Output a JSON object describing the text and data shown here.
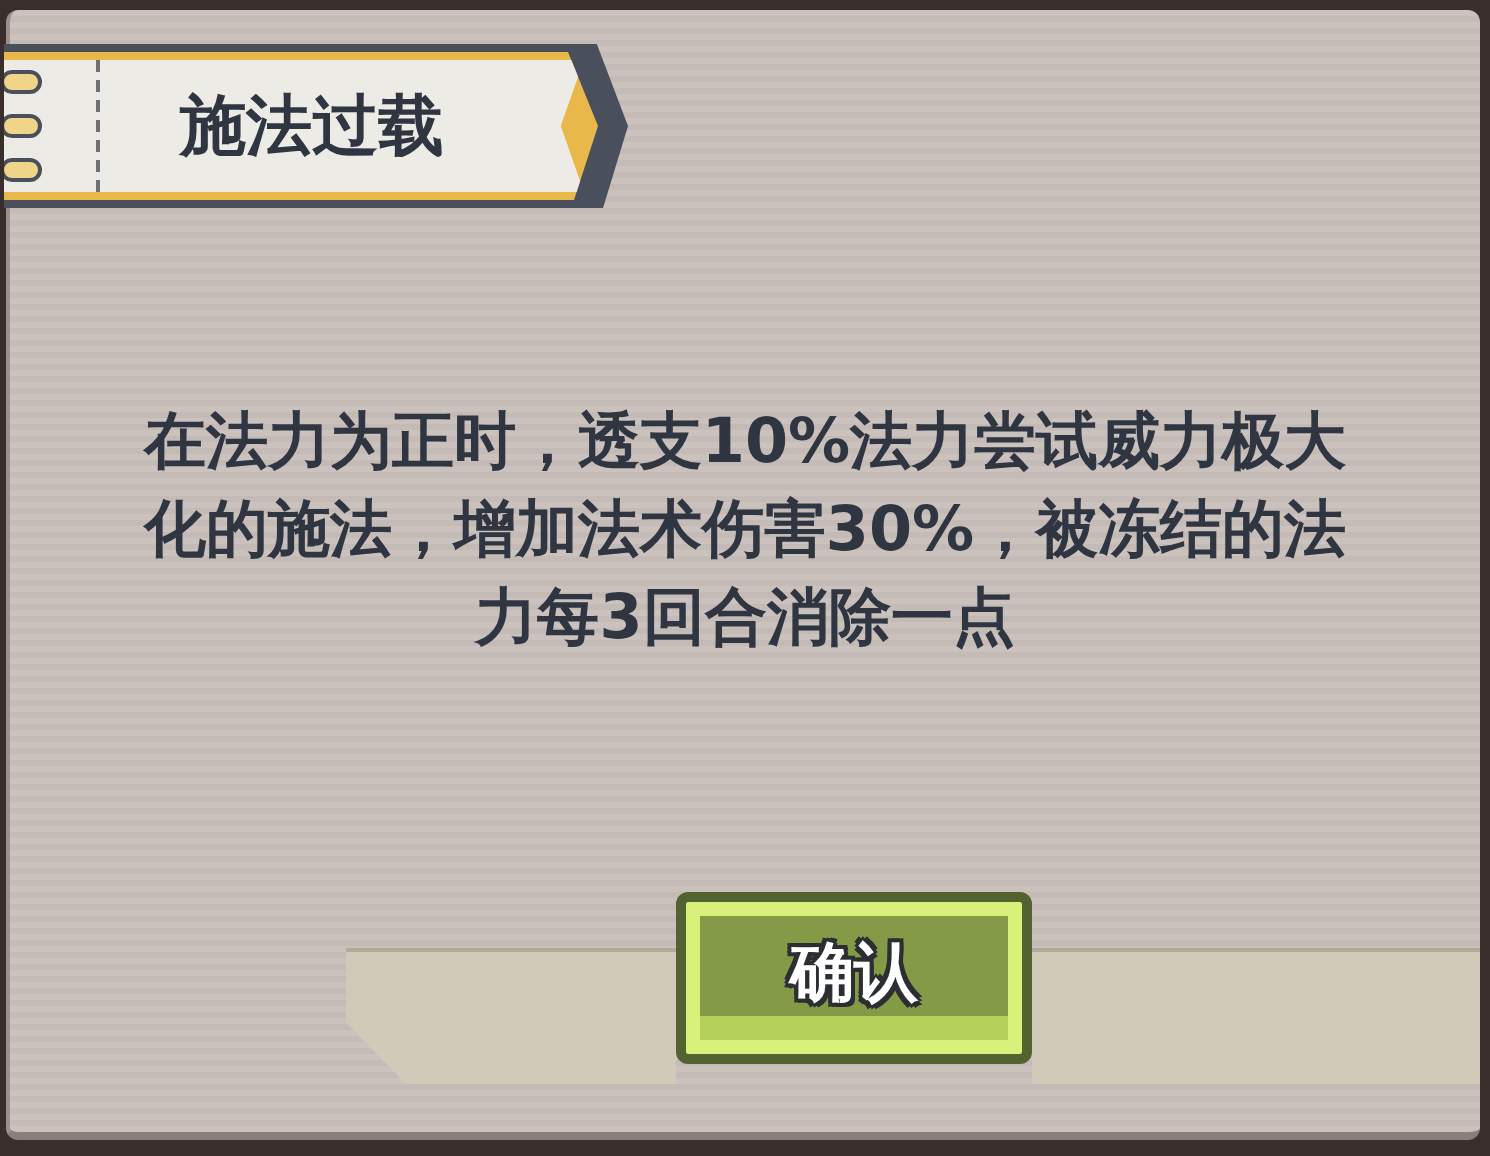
{
  "dialog": {
    "title": "施法过载",
    "description": "在法力为正时，透支10%法力尝试威力极大化的施法，增加法术伤害30%，被冻结的法力每3回合消除一点",
    "buttons": [
      {
        "label": "确认",
        "kind": "confirm"
      }
    ]
  }
}
